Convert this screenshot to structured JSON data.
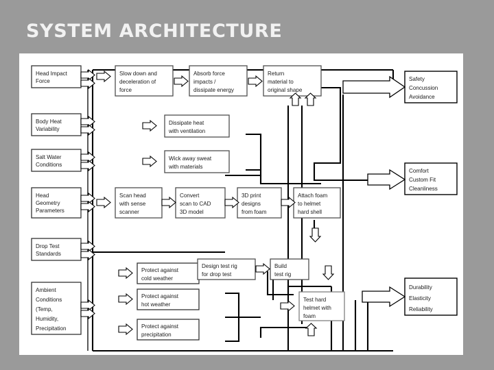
{
  "slide": {
    "title": "SYSTEM ARCHITECTURE",
    "background_color": "#9a9a9a",
    "panel_color": "#ffffff",
    "title_color": "#f2f2f2"
  },
  "diagram": {
    "type": "flow-architecture",
    "inputs": [
      {
        "id": "head-impact-force",
        "lines": [
          "Head Impact",
          "Force"
        ]
      },
      {
        "id": "body-heat-variability",
        "lines": [
          "Body Heat",
          "Variability"
        ]
      },
      {
        "id": "salt-water-conditions",
        "lines": [
          "Salt Water",
          "Conditions"
        ]
      },
      {
        "id": "head-geometry-parameters",
        "lines": [
          "Head",
          "Geometry",
          "Parameters"
        ]
      },
      {
        "id": "drop-test-standards",
        "lines": [
          "Drop Test",
          "Standards"
        ]
      },
      {
        "id": "ambient-conditions",
        "lines": [
          "Ambient",
          "Conditions",
          "(Temp,",
          "Humidity,",
          "Precipitation"
        ]
      }
    ],
    "processes": [
      {
        "id": "slow-down-deceleration",
        "lines": [
          "Slow down and",
          "deceleration of",
          "force"
        ]
      },
      {
        "id": "absorb-force-impacts",
        "lines": [
          "Absorb force",
          "impacts /",
          "dissipate energy"
        ]
      },
      {
        "id": "return-material-shape",
        "lines": [
          "Return",
          "material to",
          "original shape"
        ]
      },
      {
        "id": "dissipate-heat-ventilation",
        "lines": [
          "Dissipate heat",
          "with ventilation"
        ]
      },
      {
        "id": "wick-away-sweat",
        "lines": [
          "Wick away sweat",
          "with materials"
        ]
      },
      {
        "id": "scan-head-sense-scanner",
        "lines": [
          "Scan head",
          "with sense",
          "scanner"
        ]
      },
      {
        "id": "convert-scan-to-cad",
        "lines": [
          "Convert",
          "scan to CAD",
          "3D model"
        ]
      },
      {
        "id": "3d-print-designs-foam",
        "lines": [
          "3D print",
          "designs",
          "from foam"
        ]
      },
      {
        "id": "attach-foam-helmet",
        "lines": [
          "Attach foam",
          "to helmet",
          "hard shell"
        ]
      },
      {
        "id": "protect-cold-weather",
        "lines": [
          "Protect against",
          "cold weather"
        ]
      },
      {
        "id": "protect-hot-weather",
        "lines": [
          "Protect against",
          "hot weather"
        ]
      },
      {
        "id": "protect-precipitation",
        "lines": [
          "Protect against",
          "precipitation"
        ]
      },
      {
        "id": "design-test-rig",
        "lines": [
          "Design test rig",
          "for drop test"
        ]
      },
      {
        "id": "build-test-rig",
        "lines": [
          "Build",
          "test rig"
        ]
      },
      {
        "id": "test-hard-helmet",
        "lines": [
          "Test hard",
          "helmet with",
          "foam"
        ]
      }
    ],
    "outputs": [
      {
        "id": "safety-concussion-avoidance",
        "lines": [
          "Safety",
          "Concussion",
          "Avoidance"
        ]
      },
      {
        "id": "comfort-custom-fit-cleanliness",
        "lines": [
          "Comfort",
          "Custom Fit",
          "Cleanliness"
        ]
      },
      {
        "id": "durability-elasticity-reliability",
        "lines": [
          "Durability",
          "Elasticity",
          "Reliability"
        ]
      }
    ]
  }
}
